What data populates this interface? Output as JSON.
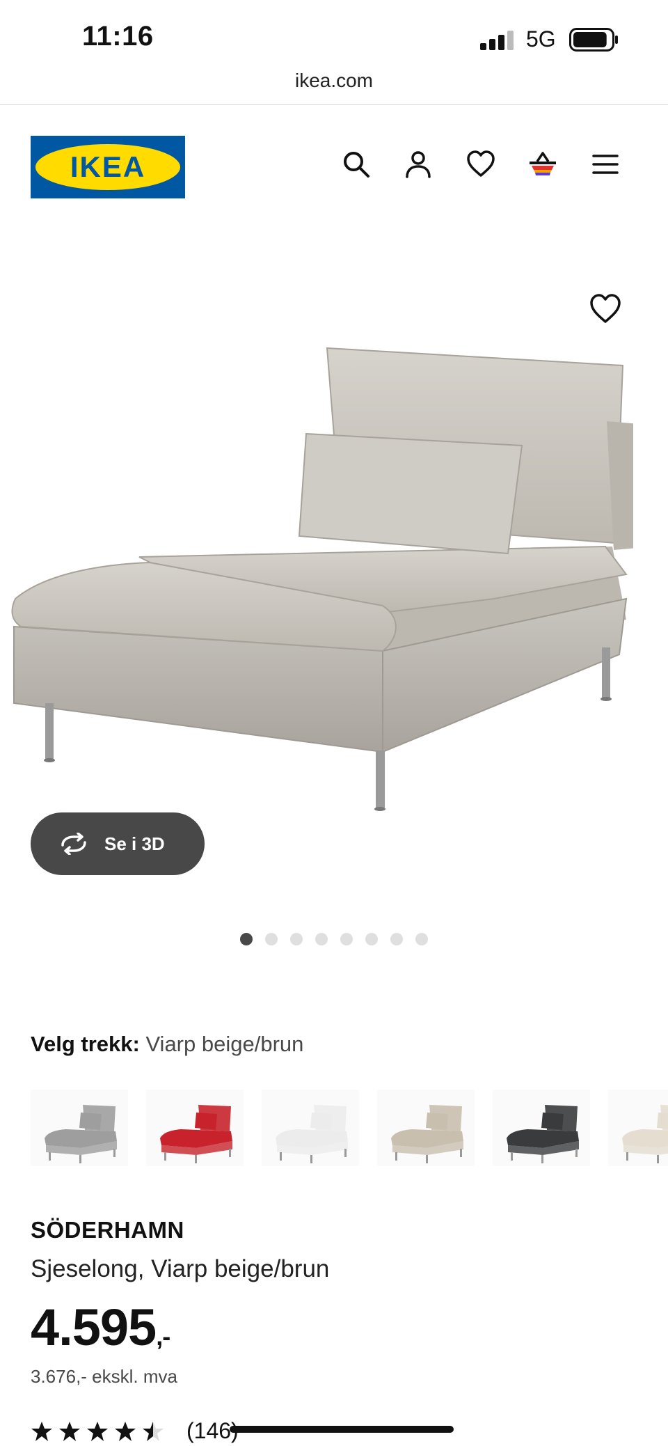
{
  "status_bar": {
    "time": "11:16",
    "network": "5G",
    "battery_level": 0.9
  },
  "browser": {
    "url": "ikea.com"
  },
  "header": {
    "logo_text": "IKEA",
    "colors": {
      "logo_blue": "#0058A3",
      "logo_yellow": "#FFDB00"
    },
    "icons": [
      "search-icon",
      "user-icon",
      "heart-icon",
      "basket-icon",
      "menu-icon"
    ]
  },
  "gallery": {
    "view_3d_label": "Se i 3D",
    "page_count": 8,
    "active_index": 0
  },
  "cover": {
    "label": "Velg trekk:",
    "value": "Viarp beige/brun",
    "swatches": [
      {
        "name": "grey",
        "color": "#9e9e9e"
      },
      {
        "name": "red",
        "color": "#c8232c"
      },
      {
        "name": "white",
        "color": "#ececec"
      },
      {
        "name": "beige",
        "color": "#c9bfae"
      },
      {
        "name": "dark-grey",
        "color": "#3a3b3d"
      },
      {
        "name": "light-beige",
        "color": "#e4ddd0"
      }
    ]
  },
  "product": {
    "name": "SÖDERHAMN",
    "description": "Sjeselong, Viarp beige/brun",
    "price": "4.595",
    "price_suffix": ",-",
    "price_ex_vat": "3.676,- ekskl. mva",
    "rating_value": 4.5,
    "rating_max": 5,
    "review_count": "(146)"
  }
}
